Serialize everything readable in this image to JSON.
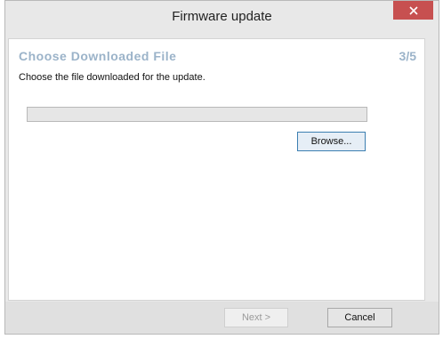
{
  "window": {
    "title": "Firmware update",
    "close_icon": "close-icon"
  },
  "step": {
    "title": "Choose Downloaded File",
    "counter": "3/5",
    "description": "Choose the file downloaded for the update."
  },
  "file_input": {
    "value": "",
    "placeholder": ""
  },
  "buttons": {
    "browse": "Browse...",
    "next": "Next >",
    "cancel": "Cancel"
  },
  "colors": {
    "close_button": "#c75050",
    "step_title": "#9bb3c9",
    "browse_border": "#3c7fb1"
  }
}
